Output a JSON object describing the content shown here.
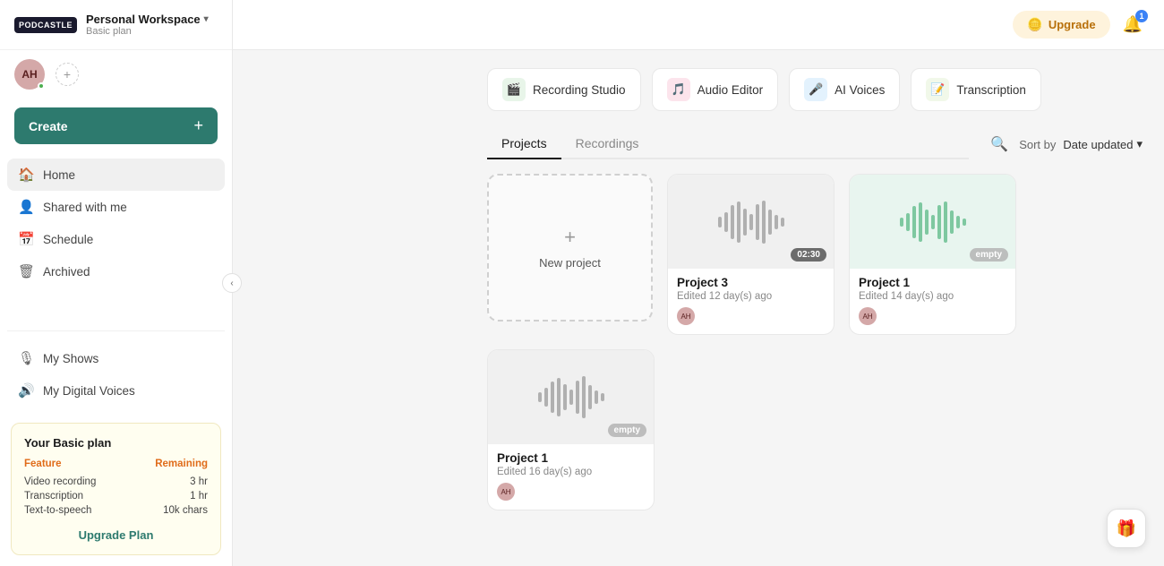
{
  "app": {
    "logo": "PODCASTLE",
    "workspace_name": "Personal Workspace",
    "workspace_plan": "Basic plan"
  },
  "header": {
    "upgrade_label": "Upgrade",
    "notification_count": "1"
  },
  "sidebar": {
    "avatar_initials": "AH",
    "create_label": "Create",
    "nav_items": [
      {
        "id": "home",
        "label": "Home",
        "icon": "🏠"
      },
      {
        "id": "shared",
        "label": "Shared with me",
        "icon": "👤"
      },
      {
        "id": "schedule",
        "label": "Schedule",
        "icon": "📅"
      },
      {
        "id": "archived",
        "label": "Archived",
        "icon": "🗑"
      }
    ],
    "nav_items_bottom": [
      {
        "id": "my-shows",
        "label": "My Shows",
        "icon": "🎙"
      },
      {
        "id": "my-digital-voices",
        "label": "My Digital Voices",
        "icon": "🔊"
      }
    ]
  },
  "plan_card": {
    "title": "Your Basic plan",
    "feature_header": "Feature",
    "remaining_header": "Remaining",
    "features": [
      {
        "name": "Video recording",
        "remaining": "3 hr"
      },
      {
        "name": "Transcription",
        "remaining": "1 hr"
      },
      {
        "name": "Text-to-speech",
        "remaining": "10k chars"
      }
    ],
    "upgrade_link": "Upgrade Plan"
  },
  "tools": [
    {
      "id": "recording-studio",
      "label": "Recording Studio",
      "icon": "🎬",
      "icon_class": "tool-icon-camera"
    },
    {
      "id": "audio-editor",
      "label": "Audio Editor",
      "icon": "🎵",
      "icon_class": "tool-icon-audio"
    },
    {
      "id": "ai-voices",
      "label": "AI Voices",
      "icon": "🎤",
      "icon_class": "tool-icon-ai"
    },
    {
      "id": "transcription",
      "label": "Transcription",
      "icon": "📝",
      "icon_class": "tool-icon-transcription"
    }
  ],
  "tabs": [
    {
      "id": "projects",
      "label": "Projects",
      "active": true
    },
    {
      "id": "recordings",
      "label": "Recordings",
      "active": false
    }
  ],
  "sort": {
    "label": "Sort by",
    "value": "Date updated"
  },
  "new_project": {
    "label": "New project"
  },
  "projects": [
    {
      "id": "project3",
      "name": "Project 3",
      "edited": "Edited 12 day(s) ago",
      "badge": "02:30",
      "badge_type": "time",
      "thumb_style": "default"
    },
    {
      "id": "project1a",
      "name": "Project 1",
      "edited": "Edited 14 day(s) ago",
      "badge": "empty",
      "badge_type": "empty",
      "thumb_style": "green"
    },
    {
      "id": "project1b",
      "name": "Project 1",
      "edited": "Edited 16 day(s) ago",
      "badge": "empty",
      "badge_type": "empty",
      "thumb_style": "default"
    }
  ]
}
